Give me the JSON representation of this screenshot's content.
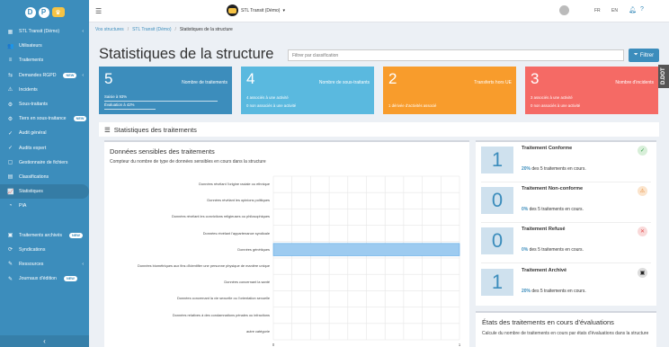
{
  "sidebar": {
    "logo": [
      "D",
      "P"
    ],
    "items": [
      {
        "icon": "building-icon",
        "glyph": "▦",
        "label": "STL Transit (Démo)",
        "chevron": "‹"
      },
      {
        "icon": "users-icon",
        "glyph": "👥",
        "label": "Utilisateurs"
      },
      {
        "icon": "list-icon",
        "glyph": "≡",
        "label": "Traitements"
      },
      {
        "icon": "request-icon",
        "glyph": "⇆",
        "label": "Demandes RGPD",
        "badge": "NEW",
        "chevron": "‹"
      },
      {
        "icon": "incident-icon",
        "glyph": "⚠",
        "label": "Incidents"
      },
      {
        "icon": "handshake-icon",
        "glyph": "⚙",
        "label": "Sous-traitants"
      },
      {
        "icon": "third-party-icon",
        "glyph": "⚙",
        "label": "Tiers en sous-traitance",
        "badge": "NEW"
      },
      {
        "icon": "audit-icon",
        "glyph": "✓",
        "label": "Audit général"
      },
      {
        "icon": "audit-expert-icon",
        "glyph": "✓",
        "label": "Audits expert"
      },
      {
        "icon": "folder-icon",
        "glyph": "▢",
        "label": "Gestionnaire de fichiers"
      },
      {
        "icon": "classification-icon",
        "glyph": "▤",
        "label": "Classifications"
      },
      {
        "icon": "chart-icon",
        "glyph": "📈",
        "label": "Statistiques",
        "active": true
      },
      {
        "icon": "pia-icon",
        "glyph": "◔",
        "label": "PIA"
      },
      {
        "icon": "archive-icon",
        "glyph": "▣",
        "label": "Traitements archivés",
        "badge": "NEW",
        "gap": true
      },
      {
        "icon": "sync-icon",
        "glyph": "⟳",
        "label": "Syndications"
      },
      {
        "icon": "resources-icon",
        "glyph": "✎",
        "label": "Ressources",
        "chevron": "‹"
      },
      {
        "icon": "journal-icon",
        "glyph": "✎",
        "label": "Journaux d'édition",
        "badge": "NEW"
      }
    ],
    "collapse": "‹"
  },
  "topbar": {
    "org": "STL Transit (Démo)",
    "caret": "▾",
    "lang_fr": "FR",
    "lang_en": "EN"
  },
  "breadcrumb": {
    "items": [
      "Vos structures",
      "STL Transit (Démo)"
    ],
    "separator": "/",
    "current": "Statistiques de la structure"
  },
  "page_title": "Statistiques de la structure",
  "filter": {
    "placeholder": "Filtrer par classification",
    "button": "Filtrer"
  },
  "dot_label": "D.DOT",
  "kpis": [
    {
      "value": "5",
      "label": "Nombre de traitements",
      "line1": "Saisie à 93%",
      "line2": "Évaluation à 42%",
      "color": "#3c8dbc",
      "bar1": 0.93,
      "bar2": 0.42
    },
    {
      "value": "4",
      "label": "Nombre de sous-traitants",
      "line1": "4 associés à une activité",
      "line2": "0 non associés à une activité",
      "color": "#5ab9df"
    },
    {
      "value": "2",
      "label": "Transferts hors UE",
      "line1": "",
      "line2": "1 dérivée d'activités associé",
      "color": "#f89c2c"
    },
    {
      "value": "3",
      "label": "Nombre d'incidents",
      "line1": "3 associés à une activité",
      "line2": "0 non associés à une activité",
      "color": "#f56a65"
    }
  ],
  "section_title": "Statistiques des traitements",
  "sensitive": {
    "title": "Données sensibles des traitements",
    "subtitle": "Compteur du nombre de type de données sensibles en cours dans la structure"
  },
  "chart_data": {
    "type": "bar",
    "orientation": "horizontal",
    "categories": [
      "Données révélant l'origine raciale ou ethnique",
      "Données révélant les opinions politiques",
      "Données révélant les convictions religieuses ou philosophiques",
      "Données révélant l'appartenance syndicale",
      "Données génétiques",
      "Données biométriques aux fins d'identifier une personne physique de manière unique",
      "Données concernant la santé",
      "Données concernant la vie sexuelle ou l'orientation sexuelle",
      "Données relatives à des condamnations pénales ou infractions",
      "autre catégorie"
    ],
    "values": [
      0,
      0,
      0,
      0,
      1,
      0,
      0,
      0,
      0,
      0
    ],
    "xlim": [
      0,
      1
    ],
    "xticks": [
      "0",
      "1"
    ],
    "color": "#9dcbf0",
    "grid": true
  },
  "status_tiles": [
    {
      "value": "1",
      "title": "Traitement Conforme",
      "pct": "20%",
      "text": " des 5 traitements en cours.",
      "icon": "check-icon",
      "glyph": "✓",
      "bg": "#d8efd9",
      "fg": "#2e9b45"
    },
    {
      "value": "0",
      "title": "Traitement Non-conforme",
      "pct": "0%",
      "text": " des 5 traitements en cours.",
      "icon": "warning-icon",
      "glyph": "⚠",
      "bg": "#fbe4cc",
      "fg": "#e67e22"
    },
    {
      "value": "0",
      "title": "Traitement Refusé",
      "pct": "0%",
      "text": " des 5 traitements en cours.",
      "icon": "cross-icon",
      "glyph": "✕",
      "bg": "#f9d9d9",
      "fg": "#e34b4b"
    },
    {
      "value": "1",
      "title": "Traitement Archivé",
      "pct": "20%",
      "text": " des 5 traitements en cours.",
      "icon": "archive-box-icon",
      "glyph": "▣",
      "bg": "#ddd",
      "fg": "#222"
    }
  ],
  "eval": {
    "title": "États des traitements en cours d'évaluations",
    "subtitle": "Calcule du nombre de traitements en cours par états d'évaluations dans la structure"
  }
}
